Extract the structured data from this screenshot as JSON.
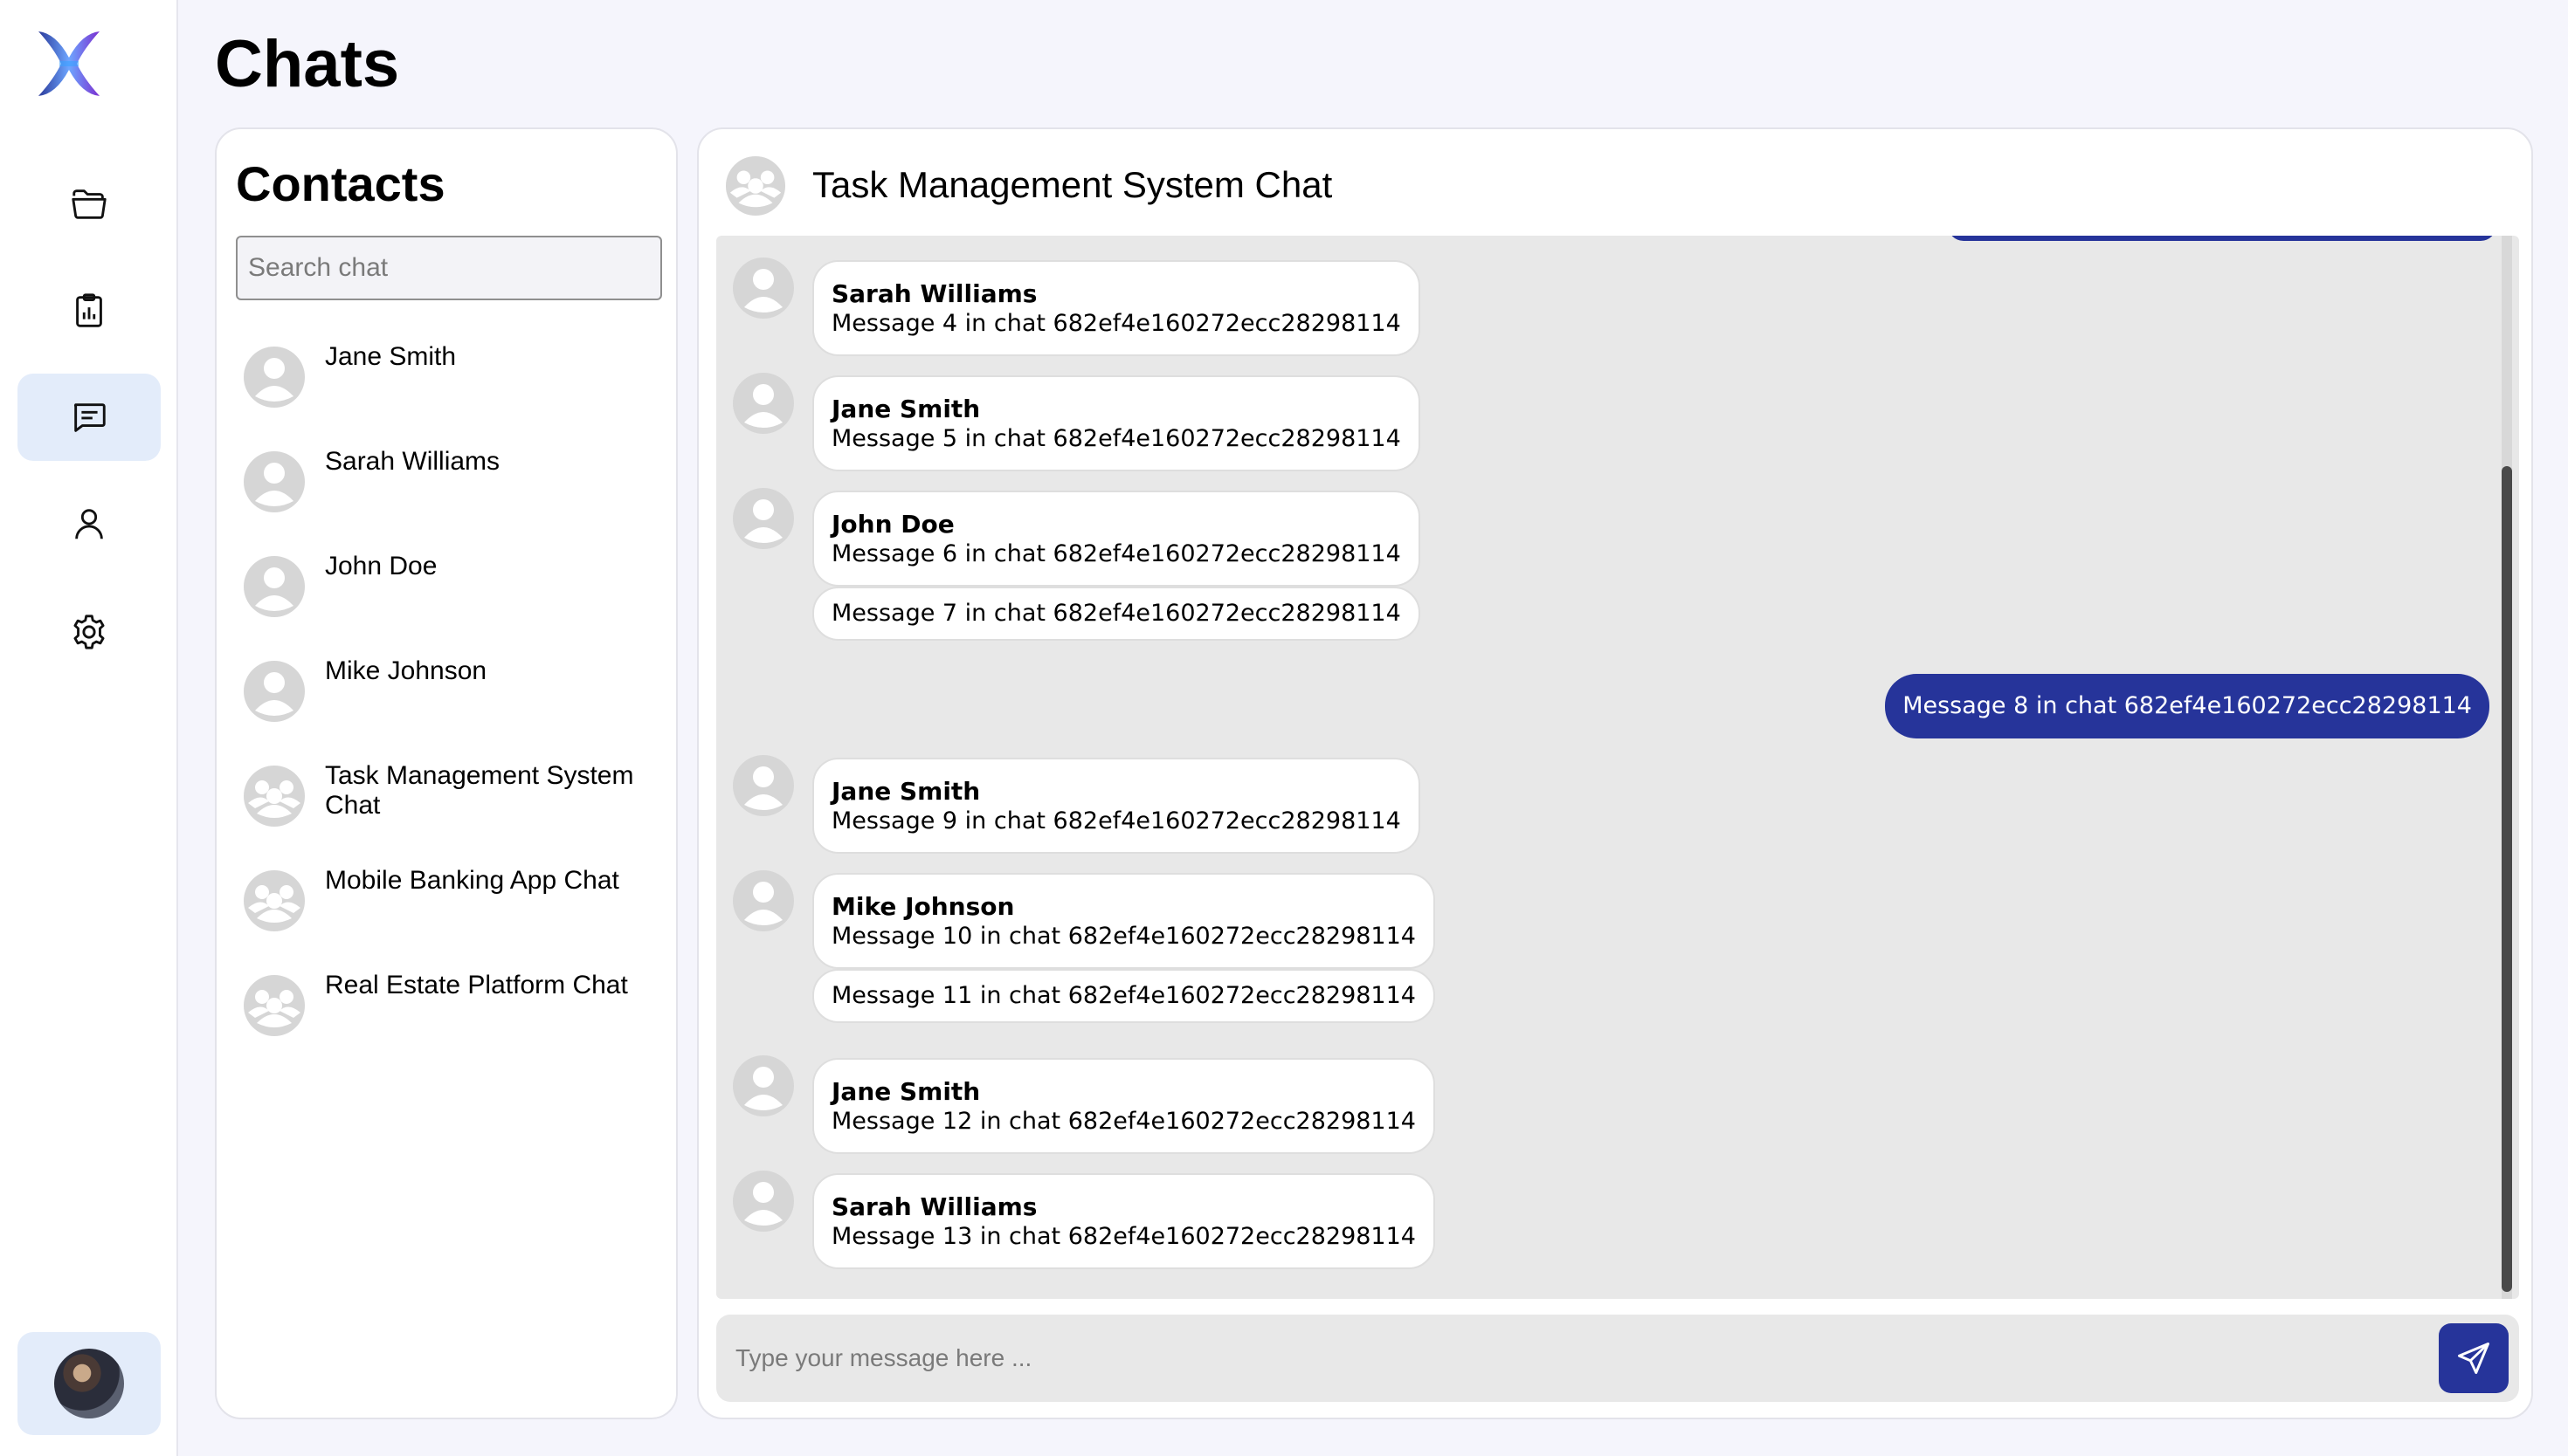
{
  "page": {
    "title": "Chats"
  },
  "contacts": {
    "title": "Contacts",
    "search_placeholder": "Search chat",
    "items": [
      {
        "name": "Jane Smith",
        "type": "user"
      },
      {
        "name": "Sarah Williams",
        "type": "user"
      },
      {
        "name": "John Doe",
        "type": "user"
      },
      {
        "name": "Mike Johnson",
        "type": "user"
      },
      {
        "name": "Task Management System Chat",
        "type": "group"
      },
      {
        "name": "Mobile Banking App Chat",
        "type": "group"
      },
      {
        "name": "Real Estate Platform Chat",
        "type": "group"
      }
    ]
  },
  "chat": {
    "title": "Task Management System Chat",
    "messages": [
      {
        "sender": "Sarah Williams",
        "text": "Message 4 in chat 682ef4e160272ecc28298114"
      },
      {
        "sender": "Jane Smith",
        "text": "Message 5 in chat 682ef4e160272ecc28298114"
      },
      {
        "sender": "John Doe",
        "text": "Message 6 in chat 682ef4e160272ecc28298114"
      },
      {
        "sender": "",
        "text": "Message 7 in chat 682ef4e160272ecc28298114"
      },
      {
        "sender": "me",
        "text": "Message 8 in chat 682ef4e160272ecc28298114"
      },
      {
        "sender": "Jane Smith",
        "text": "Message 9 in chat 682ef4e160272ecc28298114"
      },
      {
        "sender": "Mike Johnson",
        "text": "Message 10 in chat 682ef4e160272ecc28298114"
      },
      {
        "sender": "",
        "text": "Message 11 in chat 682ef4e160272ecc28298114"
      },
      {
        "sender": "Jane Smith",
        "text": "Message 12 in chat 682ef4e160272ecc28298114"
      },
      {
        "sender": "Sarah Williams",
        "text": "Message 13 in chat 682ef4e160272ecc28298114"
      }
    ],
    "composer_placeholder": "Type your message here ..."
  },
  "nav": {
    "items": [
      "folder-icon",
      "clipboard-chart-icon",
      "chat-icon",
      "user-icon",
      "gear-icon"
    ],
    "active": "chat-icon"
  },
  "colors": {
    "accent": "#26349a",
    "active_nav": "#e3ecfa",
    "message_area": "#e8e8e8",
    "background": "#f5f5fc"
  }
}
